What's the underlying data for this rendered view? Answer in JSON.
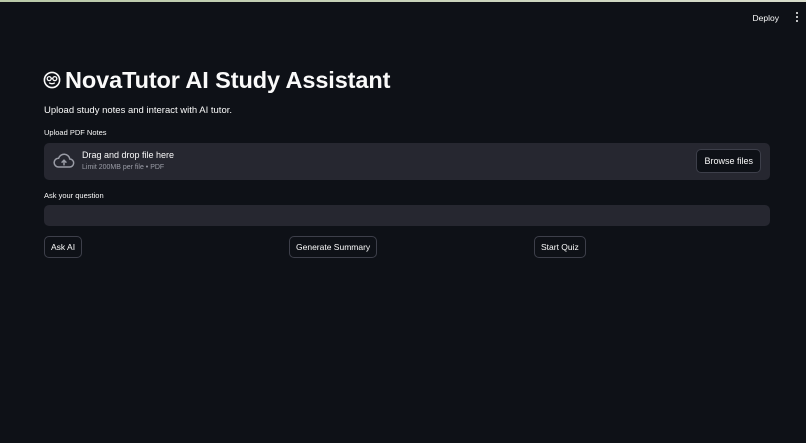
{
  "header": {
    "deploy_label": "Deploy",
    "menu_icon": "kebab-menu-icon"
  },
  "main": {
    "title_icon": "nerd-face-emoji-icon",
    "title": "NovaTutor AI Study Assistant",
    "subtitle": "Upload study notes and interact with AI tutor."
  },
  "uploader": {
    "label": "Upload PDF Notes",
    "icon": "cloud-upload-icon",
    "drop_text": "Drag and drop file here",
    "limit_text": "Limit 200MB per file • PDF",
    "browse_label": "Browse files"
  },
  "question": {
    "label": "Ask your question",
    "value": ""
  },
  "actions": {
    "ask_label": "Ask AI",
    "summary_label": "Generate Summary",
    "quiz_label": "Start Quiz"
  },
  "colors": {
    "background": "#0e1117",
    "surface": "#262730",
    "text": "#fafafa",
    "muted_text": "#9a9ca6",
    "border": "#3d3f4a"
  }
}
